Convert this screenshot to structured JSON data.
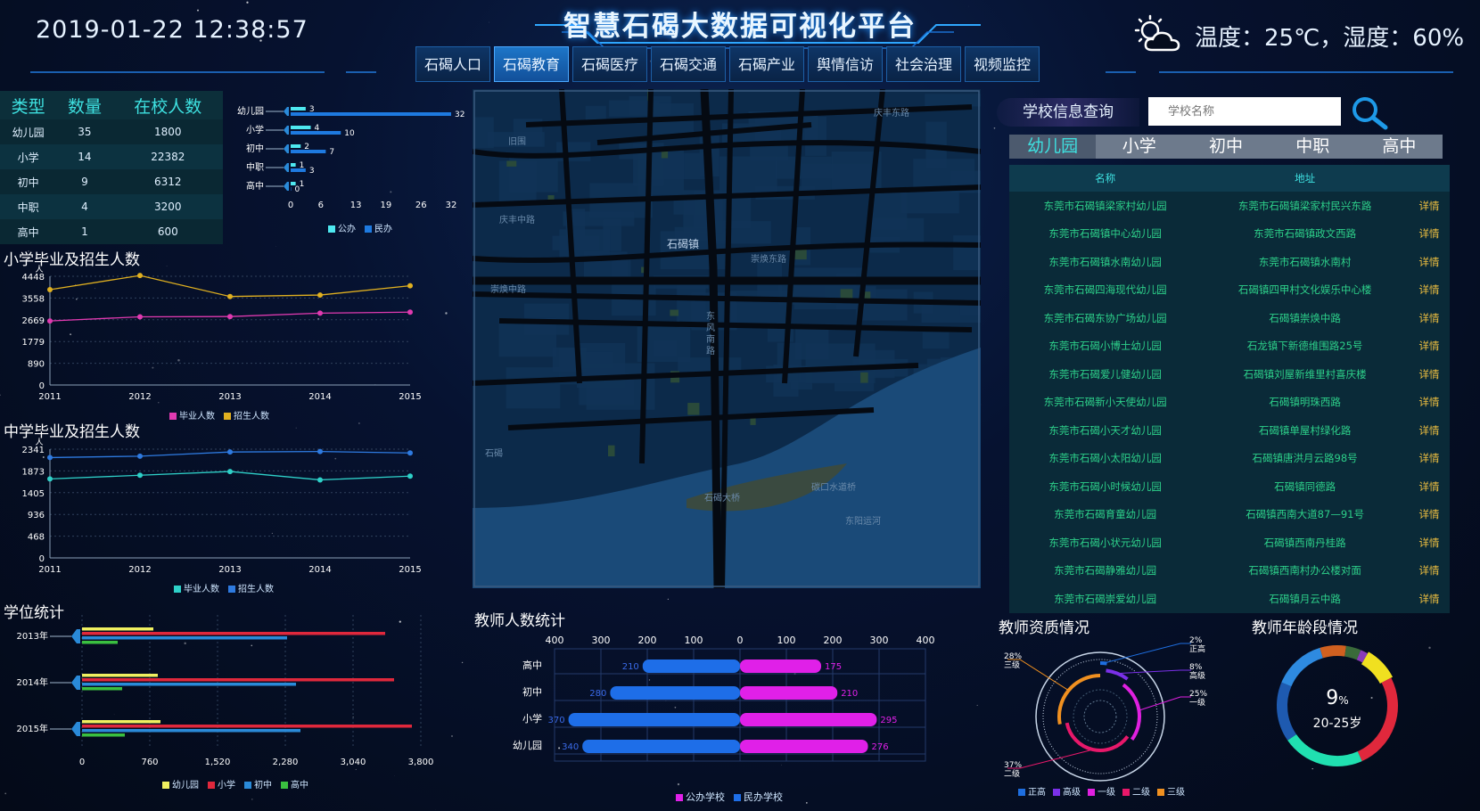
{
  "header": {
    "datetime": "2019-01-22 12:38:57",
    "title": "智慧石碣大数据可视化平台",
    "weather": "温度：25℃，湿度：60%"
  },
  "nav": {
    "items": [
      "石碣人口",
      "石碣教育",
      "石碣医疗",
      "石碣交通",
      "石碣产业",
      "舆情信访",
      "社会治理",
      "视频监控"
    ],
    "active_index": 1
  },
  "type_table": {
    "headers": [
      "类型",
      "数量",
      "在校人数"
    ],
    "rows": [
      [
        "幼儿园",
        "35",
        "1800"
      ],
      [
        "小学",
        "14",
        "22382"
      ],
      [
        "初中",
        "9",
        "6312"
      ],
      [
        "中职",
        "4",
        "3200"
      ],
      [
        "高中",
        "1",
        "600"
      ]
    ]
  },
  "school_count_chart": {
    "type": "bar",
    "categories": [
      "幼儿园",
      "小学",
      "初中",
      "中职",
      "高中"
    ],
    "series": [
      {
        "name": "公办",
        "values": [
          3,
          4,
          2,
          1,
          1
        ],
        "color": "#4ee8f0"
      },
      {
        "name": "民办",
        "values": [
          32,
          10,
          7,
          3,
          0
        ],
        "color": "#1e7ae0"
      }
    ],
    "xticks": [
      "0",
      "6",
      "13",
      "19",
      "26",
      "32"
    ],
    "xlim": [
      0,
      32
    ]
  },
  "sections": {
    "primary": "小学毕业及招生人数",
    "middle": "中学毕业及招生人数",
    "degree": "学位统计",
    "teacher_count": "教师人数统计",
    "teacher_quality": "教师资质情况",
    "teacher_age": "教师年龄段情况"
  },
  "map_labels": [
    "庆丰东路",
    "旧围",
    "庆丰中路",
    "石碣镇",
    "崇焕东路",
    "崇焕中路",
    "东风南路",
    "石碣",
    "石碣大桥",
    "碳口水道桥",
    "东阳运河"
  ],
  "right_panel": {
    "query_label": "学校信息查询",
    "search_placeholder": "学校名称",
    "tabs": [
      "幼儿园",
      "小学",
      "初中",
      "中职",
      "高中"
    ],
    "active_tab": 0,
    "table_headers": [
      "名称",
      "地址",
      ""
    ],
    "detail_label": "详情",
    "schools": [
      [
        "东莞市石碣镇梁家村幼儿园",
        "东莞市石碣镇梁家村民兴东路"
      ],
      [
        "东莞市石碣镇中心幼儿园",
        "东莞市石碣镇政文西路"
      ],
      [
        "东莞市石碣镇水南幼儿园",
        "东莞市石碣镇水南村"
      ],
      [
        "东莞市石碣四海现代幼儿园",
        "石碣镇四甲村文化娱乐中心楼"
      ],
      [
        "东莞市石碣东协广场幼儿园",
        "石碣镇崇焕中路"
      ],
      [
        "东莞市石碣小博士幼儿园",
        "石龙镇下新德维围路25号"
      ],
      [
        "东莞市石碣爱儿健幼儿园",
        "石碣镇刘屋新维里村喜庆楼"
      ],
      [
        "东莞市石碣新小天使幼儿园",
        "石碣镇明珠西路"
      ],
      [
        "东莞市石碣小天才幼儿园",
        "石碣镇单屋村绿化路"
      ],
      [
        "东莞市石碣小太阳幼儿园",
        "石碣镇唐洪月云路98号"
      ],
      [
        "东莞市石碣小时候幼儿园",
        "石碣镇同德路"
      ],
      [
        "东莞市石碣育童幼儿园",
        "石碣镇西南大道87—91号"
      ],
      [
        "东莞市石碣小状元幼儿园",
        "石碣镇西南丹桂路"
      ],
      [
        "东莞市石碣静雅幼儿园",
        "石碣镇西南村办公楼对面"
      ],
      [
        "东莞市石碣崇爱幼儿园",
        "石碣镇月云中路"
      ]
    ]
  },
  "chart_data": [
    {
      "id": "primary",
      "type": "line",
      "x": [
        "2011",
        "2012",
        "2013",
        "2014",
        "2015"
      ],
      "ylabel": "人",
      "yticks": [
        "0",
        "890",
        "1779",
        "2669",
        "3558",
        "4448"
      ],
      "ylim": [
        0,
        4448
      ],
      "series": [
        {
          "name": "毕业人数",
          "values": [
            2620,
            2790,
            2800,
            2940,
            2980
          ],
          "color": "#e03ab0"
        },
        {
          "name": "招生人数",
          "values": [
            3900,
            4480,
            3620,
            3680,
            4060
          ],
          "color": "#e0b020"
        }
      ]
    },
    {
      "id": "middle",
      "type": "line",
      "x": [
        "2011",
        "2012",
        "2013",
        "2014",
        "2015"
      ],
      "ylabel": "人",
      "yticks": [
        "0",
        "468",
        "936",
        "1405",
        "1873",
        "2341"
      ],
      "ylim": [
        0,
        2341
      ],
      "series": [
        {
          "name": "毕业人数",
          "values": [
            1700,
            1780,
            1860,
            1680,
            1760
          ],
          "color": "#2ed0c8"
        },
        {
          "name": "招生人数",
          "values": [
            2160,
            2190,
            2280,
            2290,
            2260
          ],
          "color": "#2e7ae0"
        }
      ]
    },
    {
      "id": "degree",
      "type": "bar",
      "categories": [
        "2013年",
        "2014年",
        "2015年"
      ],
      "xticks": [
        "0",
        "760",
        "1,520",
        "2,280",
        "3,040",
        "3,800"
      ],
      "xlim": [
        0,
        3800
      ],
      "series": [
        {
          "name": "幼儿园",
          "values": [
            800,
            850,
            880
          ],
          "color": "#f0f060"
        },
        {
          "name": "小学",
          "values": [
            3400,
            3500,
            3700
          ],
          "color": "#e0283c"
        },
        {
          "name": "初中",
          "values": [
            2300,
            2400,
            2450
          ],
          "color": "#2a8ad8"
        },
        {
          "name": "高中",
          "values": [
            400,
            450,
            480
          ],
          "color": "#3ac040"
        }
      ]
    },
    {
      "id": "teacher_count",
      "type": "bar",
      "categories": [
        "高中",
        "初中",
        "小学",
        "幼儿园"
      ],
      "xticks": [
        "400",
        "300",
        "200",
        "100",
        "0",
        "100",
        "200",
        "300",
        "400"
      ],
      "series": [
        {
          "name": "公办学校",
          "values": [
            175,
            210,
            295,
            276
          ],
          "color": "#e020e8"
        },
        {
          "name": "民办学校",
          "values": [
            210,
            280,
            370,
            340
          ],
          "color": "#1e6ee8"
        }
      ]
    },
    {
      "id": "teacher_quality",
      "type": "pie",
      "series": [
        {
          "name": "正高",
          "value": 2,
          "label": "2%",
          "color": "#1e6ee0"
        },
        {
          "name": "高级",
          "value": 8,
          "label": "8%",
          "color": "#7a30e8"
        },
        {
          "name": "一级",
          "value": 25,
          "label": "25%",
          "color": "#e020e0"
        },
        {
          "name": "二级",
          "value": 37,
          "label": "37%",
          "color": "#e8186a"
        },
        {
          "name": "三级",
          "value": 28,
          "label": "28%",
          "color": "#f09020"
        }
      ]
    },
    {
      "id": "teacher_age",
      "type": "pie",
      "center_value": "9",
      "center_unit": "%",
      "center_label": "20-25岁",
      "series": [
        {
          "value": 9,
          "color": "#f0e020"
        },
        {
          "value": 26,
          "color": "#e0283c"
        },
        {
          "value": 22,
          "color": "#20e0b0"
        },
        {
          "value": 16,
          "color": "#1e5ab0"
        },
        {
          "value": 14,
          "color": "#2e8ae0"
        },
        {
          "value": 7,
          "color": "#d06020"
        },
        {
          "value": 4,
          "color": "#3a6a3a"
        },
        {
          "value": 2,
          "color": "#8a3ab8"
        }
      ]
    }
  ]
}
